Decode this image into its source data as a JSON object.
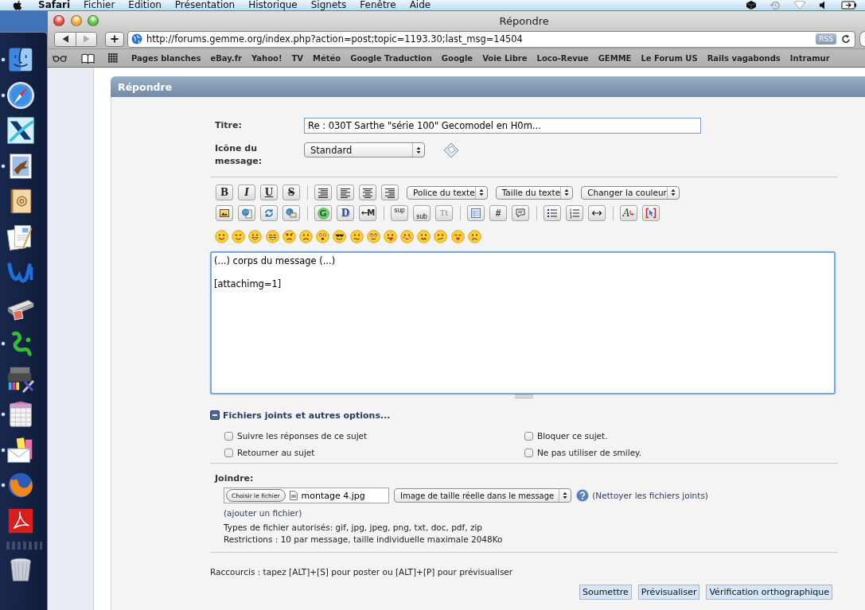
{
  "menu_bar": {
    "app_name": "Safari",
    "menus": [
      "Fichier",
      "Edition",
      "Présentation",
      "Historique",
      "Signets",
      "Fenêtre",
      "Aide"
    ]
  },
  "dock": {
    "apps": [
      {
        "kind": "finder",
        "running": true
      },
      {
        "kind": "compass",
        "running": true
      },
      {
        "kind": "diagonal-tile",
        "running": false
      },
      {
        "kind": "stamp",
        "running": true
      },
      {
        "kind": "address-book",
        "running": false
      },
      {
        "kind": "documents",
        "running": false
      },
      {
        "kind": "swoosh",
        "running": false
      },
      {
        "kind": "scanner",
        "running": false
      },
      {
        "kind": "squiggle",
        "running": true
      },
      {
        "kind": "printer-tools",
        "running": false
      },
      {
        "kind": "calendar",
        "running": true
      },
      {
        "kind": "envelope",
        "running": true
      },
      {
        "kind": "fox-globe",
        "running": true
      },
      {
        "kind": "pdf",
        "running": false
      }
    ],
    "stacks": [
      {
        "kind": "trash",
        "running": false
      }
    ]
  },
  "window": {
    "title": "Répondre"
  },
  "toolbar": {
    "back": {
      "disabled": false
    },
    "forward": {
      "disabled": true
    },
    "url": "http://forums.gemme.org/index.php?action=post;topic=1193.30;last_msg=14504",
    "rss": "RSS"
  },
  "bookmarks_bar": {
    "items": [
      "Pages blanches",
      "eBay.fr",
      "Yahoo!",
      "TV",
      "Météo",
      "Google Traduction",
      "Google",
      "Voie Libre",
      "Loco-Revue",
      "GEMME",
      "Le Forum US",
      "Rails vagabonds",
      "Intramur"
    ]
  },
  "page": {
    "header": "Répondre",
    "subject": {
      "label": "Titre:",
      "value": "Re : 030T Sarthe \"série 100\" Gecomodel en H0m..."
    },
    "message_icon": {
      "label": "Icône du message:",
      "value": "Standard"
    },
    "editor_toolbar": {
      "rows": [
        {
          "groups": [
            {
              "buttons": [
                {
                  "kind": "bold",
                  "label": "B"
                },
                {
                  "kind": "italic",
                  "label": "I"
                },
                {
                  "kind": "underline",
                  "label": "U"
                },
                {
                  "kind": "strike",
                  "label": "S"
                }
              ]
            },
            {
              "buttons": [
                {
                  "kind": "preformatted"
                },
                {
                  "kind": "align-left"
                },
                {
                  "kind": "align-center"
                },
                {
                  "kind": "align-right"
                }
              ]
            }
          ],
          "selects": [
            "Police du texte",
            "Taille du texte",
            "Changer la couleur"
          ]
        },
        {
          "groups": [
            {
              "buttons": [
                {
                  "kind": "image"
                },
                {
                  "kind": "globe-page"
                },
                {
                  "kind": "arrows"
                },
                {
                  "kind": "globe-screen"
                }
              ]
            },
            {
              "buttons": [
                {
                  "kind": "glow",
                  "label": "G"
                },
                {
                  "kind": "shadow",
                  "label": "D"
                },
                {
                  "kind": "move",
                  "label": "←M"
                }
              ]
            },
            {
              "buttons": [
                {
                  "kind": "sup",
                  "label": "sup"
                },
                {
                  "kind": "sub",
                  "label": "sub"
                },
                {
                  "kind": "teletype",
                  "label": "Tt"
                }
              ]
            },
            {
              "buttons": [
                {
                  "kind": "table"
                },
                {
                  "kind": "code",
                  "label": "#"
                },
                {
                  "kind": "quote"
                }
              ]
            },
            {
              "buttons": [
                {
                  "kind": "bullet-list"
                },
                {
                  "kind": "numbered-list"
                },
                {
                  "kind": "horizontal-rule"
                }
              ]
            },
            {
              "buttons": [
                {
                  "kind": "face",
                  "label": "A"
                },
                {
                  "kind": "select-bracket"
                }
              ]
            }
          ]
        }
      ],
      "smileys": [
        {
          "kind": "smiley"
        },
        {
          "kind": "wink"
        },
        {
          "kind": "cheesy"
        },
        {
          "kind": "grin"
        },
        {
          "kind": "angry"
        },
        {
          "kind": "sad"
        },
        {
          "kind": "shocked"
        },
        {
          "kind": "cool"
        },
        {
          "kind": "huh"
        },
        {
          "kind": "rolleyes"
        },
        {
          "kind": "tongue"
        },
        {
          "kind": "embarrassed"
        },
        {
          "kind": "lipsrsealed"
        },
        {
          "kind": "undecided"
        },
        {
          "kind": "kiss"
        },
        {
          "kind": "cry"
        }
      ]
    },
    "message": "(...) corps du message (...)\n\n[attachimg=1]",
    "options": {
      "heading": "Fichiers joints et autres options...",
      "expanded": true,
      "checkboxes": [
        {
          "label": "Suivre les réponses de ce sujet",
          "checked": false
        },
        {
          "label": "Bloquer ce sujet.",
          "checked": false
        },
        {
          "label": "Retourner au sujet",
          "checked": false
        },
        {
          "label": "Ne pas utiliser de smiley.",
          "checked": false
        }
      ]
    },
    "attachments": {
      "label": "Joindre:",
      "choose_button": "Choisir le fichier",
      "file_name": "montage 4.jpg",
      "size_select": "Image de taille réelle dans le message",
      "clean_link": "(Nettoyer les fichiers joints)",
      "add_link": "(ajouter un fichier)",
      "allowed_types": "Types de fichier autorisés: gif, jpg, jpeg, png, txt, doc, pdf, zip",
      "restrictions": "Restrictions : 10 par message, taille individuelle maximale 2048Ko"
    },
    "shortcuts": "Raccourcis : tapez [ALT]+[S] pour poster ou [ALT]+[P] pour prévisualiser",
    "buttons": [
      "Soumettre",
      "Prévisualiser",
      "Vérification orthographique"
    ]
  }
}
